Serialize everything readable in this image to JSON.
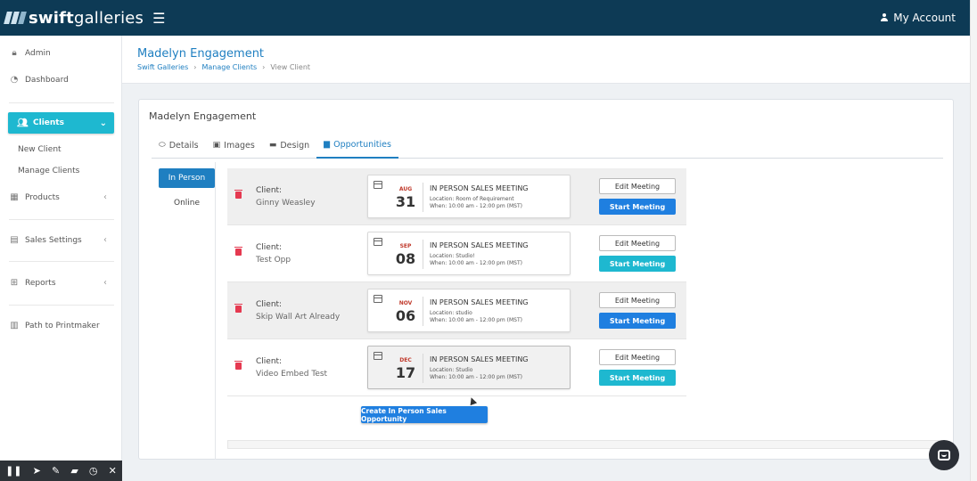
{
  "header": {
    "logo_light": "swift",
    "logo_bold": "galleries",
    "account_label": "My Account"
  },
  "sidebar": {
    "items": [
      {
        "label": "Admin",
        "icon": "lock-icon"
      },
      {
        "label": "Dashboard",
        "icon": "dashboard-icon"
      },
      {
        "label": "Clients",
        "icon": "users-icon"
      },
      {
        "label": "New Client"
      },
      {
        "label": "Manage Clients"
      },
      {
        "label": "Products",
        "icon": "products-icon"
      },
      {
        "label": "Sales Settings",
        "icon": "sales-icon"
      },
      {
        "label": "Reports",
        "icon": "table-icon"
      },
      {
        "label": "Path to Printmaker",
        "icon": "map-icon"
      }
    ]
  },
  "page": {
    "title": "Madelyn Engagement",
    "breadcrumb": [
      "Swift Galleries",
      "Manage Clients",
      "View Client"
    ]
  },
  "card": {
    "title": "Madelyn Engagement",
    "tabs": [
      "Details",
      "Images",
      "Design",
      "Opportunities"
    ],
    "pills": [
      "In Person",
      "Online"
    ],
    "client_label": "Client:",
    "meeting_title": "IN PERSON SALES MEETING",
    "edit_label": "Edit Meeting",
    "start_label": "Start Meeting",
    "opportunities": [
      {
        "client": "Ginny Weasley",
        "month": "AUG",
        "day": "31",
        "location": "Location: Room of Requirement",
        "when": "When: 10:00 am - 12:00 pm (MST)"
      },
      {
        "client": "Test Opp",
        "month": "SEP",
        "day": "08",
        "location": "Location: Studio!",
        "when": "When: 10:00 am - 12:00 pm (MST)"
      },
      {
        "client": "Skip Wall Art Already",
        "month": "NOV",
        "day": "06",
        "location": "Location: studio",
        "when": "When: 10:00 am - 12:00 pm (MST)"
      },
      {
        "client": "Video Embed Test",
        "month": "DEC",
        "day": "17",
        "location": "Location: Studio",
        "when": "When: 10:00 am - 12:00 pm (MST)"
      }
    ],
    "create_label": "Create In Person Sales Opportunity"
  },
  "colors": {
    "topbar": "#0d3a55",
    "accent_blue": "#1f7fe0",
    "accent_cyan": "#1eb8d0",
    "trash_red": "#e53950"
  }
}
